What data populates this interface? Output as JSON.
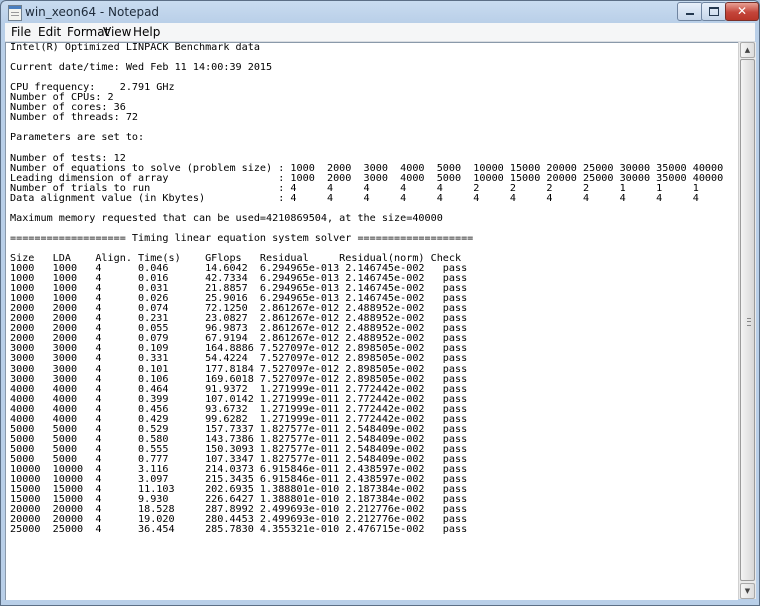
{
  "window": {
    "title": "win_xeon64 - Notepad",
    "controls": {
      "minimize": "",
      "maximize": "",
      "close": "✕"
    }
  },
  "menu": [
    "File",
    "Edit",
    "Format",
    "View",
    "Help"
  ],
  "document": {
    "text": "Intel(R) Optimized LINPACK Benchmark data\n\nCurrent date/time: Wed Feb 11 14:00:39 2015\n\nCPU frequency:    2.791 GHz\nNumber of CPUs: 2\nNumber of cores: 36\nNumber of threads: 72\n\nParameters are set to:\n\nNumber of tests: 12\nNumber of equations to solve (problem size) : 1000  2000  3000  4000  5000  10000 15000 20000 25000 30000 35000 40000\nLeading dimension of array                  : 1000  2000  3000  4000  5000  10000 15000 20000 25000 30000 35000 40000\nNumber of trials to run                     : 4     4     4     4     4     2     2     2     2     1     1     1\nData alignment value (in Kbytes)            : 4     4     4     4     4     4     4     4     4     4     4     4\n\nMaximum memory requested that can be used=4210869504, at the size=40000\n\n=================== Timing linear equation system solver ===================\n\nSize   LDA    Align. Time(s)    GFlops   Residual     Residual(norm) Check\n1000   1000   4      0.046      14.6042  6.294965e-013 2.146745e-002   pass\n1000   1000   4      0.016      42.7334  6.294965e-013 2.146745e-002   pass\n1000   1000   4      0.031      21.8857  6.294965e-013 2.146745e-002   pass\n1000   1000   4      0.026      25.9016  6.294965e-013 2.146745e-002   pass\n2000   2000   4      0.074      72.1250  2.861267e-012 2.488952e-002   pass\n2000   2000   4      0.231      23.0827  2.861267e-012 2.488952e-002   pass\n2000   2000   4      0.055      96.9873  2.861267e-012 2.488952e-002   pass\n2000   2000   4      0.079      67.9194  2.861267e-012 2.488952e-002   pass\n3000   3000   4      0.109      164.8886 7.527097e-012 2.898505e-002   pass\n3000   3000   4      0.331      54.4224  7.527097e-012 2.898505e-002   pass\n3000   3000   4      0.101      177.8184 7.527097e-012 2.898505e-002   pass\n3000   3000   4      0.106      169.6018 7.527097e-012 2.898505e-002   pass\n4000   4000   4      0.464      91.9372  1.271999e-011 2.772442e-002   pass\n4000   4000   4      0.399      107.0142 1.271999e-011 2.772442e-002   pass\n4000   4000   4      0.456      93.6732  1.271999e-011 2.772442e-002   pass\n4000   4000   4      0.429      99.6282  1.271999e-011 2.772442e-002   pass\n5000   5000   4      0.529      157.7337 1.827577e-011 2.548409e-002   pass\n5000   5000   4      0.580      143.7386 1.827577e-011 2.548409e-002   pass\n5000   5000   4      0.555      150.3093 1.827577e-011 2.548409e-002   pass\n5000   5000   4      0.777      107.3347 1.827577e-011 2.548409e-002   pass\n10000  10000  4      3.116      214.0373 6.915846e-011 2.438597e-002   pass\n10000  10000  4      3.097      215.3435 6.915846e-011 2.438597e-002   pass\n15000  15000  4      11.103     202.6935 1.388801e-010 2.187384e-002   pass\n15000  15000  4      9.930      226.6427 1.388801e-010 2.187384e-002   pass\n20000  20000  4      18.528     287.8992 2.499693e-010 2.212776e-002   pass\n20000  20000  4      19.020     280.4453 2.499693e-010 2.212776e-002   pass\n25000  25000  4      36.454     285.7830 4.355321e-010 2.476715e-002   pass"
  },
  "scrollbar": {
    "up_arrow": "▲",
    "down_arrow": "▼"
  }
}
